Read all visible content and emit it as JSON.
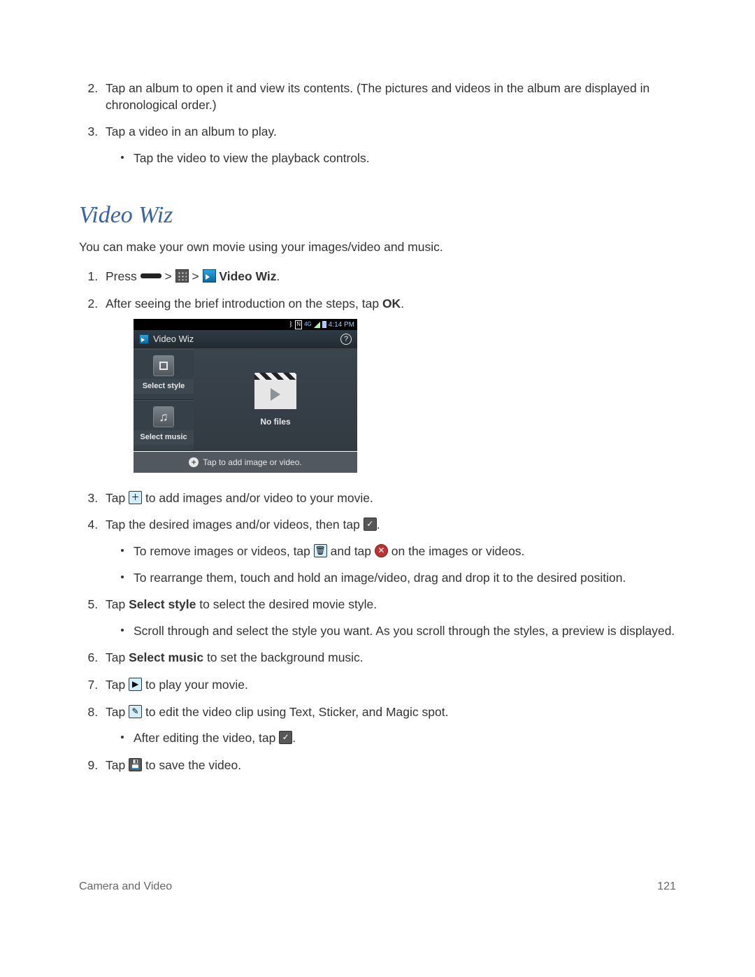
{
  "topList": {
    "item2": "Tap an album to open it and view its contents. (The pictures and videos in the album are displayed in chronological order.)",
    "item3": "Tap a video in an album to play.",
    "item3_sub1": "Tap the video to view the playback controls."
  },
  "heading": "Video Wiz",
  "intro": "You can make your own movie using your images/video and music.",
  "steps": {
    "s1_a": "Press ",
    "s1_b": " > ",
    "s1_c": " > ",
    "s1_d": " Video Wiz",
    "s1_e": ".",
    "s2_a": "After seeing the brief introduction on the steps, tap ",
    "s2_b": "OK",
    "s2_c": ".",
    "s3_a": "Tap ",
    "s3_b": " to add images and/or video to your movie.",
    "s4_a": "Tap the desired images and/or videos, then tap ",
    "s4_b": ".",
    "s4_sub1_a": "To remove images or videos, tap ",
    "s4_sub1_b": " and tap ",
    "s4_sub1_c": " on the images or videos.",
    "s4_sub2": "To rearrange them, touch and hold an image/video, drag and drop it to the desired position.",
    "s5_a": "Tap ",
    "s5_b": "Select style",
    "s5_c": " to select the desired movie style.",
    "s5_sub1": "Scroll through and select the style you want. As you scroll through the styles, a preview is displayed.",
    "s6_a": "Tap ",
    "s6_b": "Select music",
    "s6_c": " to set the background music.",
    "s7_a": "Tap ",
    "s7_b": " to play your movie.",
    "s8_a": "Tap ",
    "s8_b": " to edit the video clip using Text, Sticker, and Magic spot.",
    "s8_sub1_a": "After editing the video, tap ",
    "s8_sub1_b": ".",
    "s9_a": "Tap ",
    "s9_b": " to save the video."
  },
  "phone": {
    "time": "4:14 PM",
    "title": "Video Wiz",
    "selectStyle": "Select style",
    "selectMusic": "Select music",
    "noFiles": "No files",
    "addPrompt": "Tap to add image or video."
  },
  "footer": {
    "left": "Camera and Video",
    "right": "121"
  }
}
